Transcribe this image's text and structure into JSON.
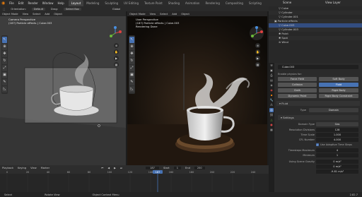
{
  "menu": {
    "items": [
      "File",
      "Edit",
      "Render",
      "Window",
      "Help"
    ]
  },
  "workspaces": [
    "Layout",
    "Modeling",
    "Sculpting",
    "UV Editing",
    "Texture Paint",
    "Shading",
    "Animation",
    "Rendering",
    "Compositing",
    "Scripting"
  ],
  "scene": {
    "name": "Scene",
    "view_layer": "View Layer"
  },
  "toolbar": {
    "transform_label": "Orientation:",
    "orientation_value": "Default",
    "drag_label": "Drag:",
    "select_box": "Select Box",
    "mode": "Object Mode",
    "view": "View",
    "select": "Select",
    "add": "Add",
    "object": "Object",
    "global": "Global"
  },
  "viewport_left": {
    "header": {
      "mode": "Object Mode",
      "view": "View",
      "select": "Select",
      "add": "Add",
      "object": "Object",
      "shading": "Normal"
    },
    "overlay_line1": "Camera Perspective",
    "overlay_line2": "(187) Particle effects | Cube.003"
  },
  "viewport_right": {
    "header": {
      "mode": "Object Mode",
      "view": "View",
      "select": "Select",
      "add": "Add",
      "object": "Object",
      "shading": "Smoke"
    },
    "overlay_line1": "User Perspective",
    "overlay_line2": "(187) Particle effects | Cube.003",
    "overlay_line3": "Rendering Done"
  },
  "outliner": {
    "rows": [
      {
        "label": "Cube",
        "indent": 2
      },
      {
        "label": "Cylinder",
        "indent": 2
      },
      {
        "label": "Cylinder.001",
        "indent": 2
      },
      {
        "label": "Particle effects",
        "indent": 1
      },
      {
        "label": "Cube.003",
        "indent": 2
      },
      {
        "label": "Cylinder.003",
        "indent": 2
      },
      {
        "label": "Point",
        "indent": 2
      },
      {
        "label": "Spot",
        "indent": 2
      },
      {
        "label": "Wind",
        "indent": 2
      }
    ],
    "selected_index": 4
  },
  "properties": {
    "object_name": "Cube.003",
    "enable_label": "Enable physics for:",
    "physics_buttons": [
      {
        "label": "Force Field",
        "active": false
      },
      {
        "label": "Soft Body",
        "active": false
      },
      {
        "label": "Collision",
        "active": false
      },
      {
        "label": "Fluid",
        "active": true
      },
      {
        "label": "Cloth",
        "active": false
      },
      {
        "label": "Rigid Body",
        "active": false
      },
      {
        "label": "Dynamic Paint",
        "active": false
      },
      {
        "label": "Rigid Body Constraint",
        "active": false
      }
    ],
    "fluid_panel": "Fluid",
    "type_label": "Type",
    "type_value": "Domain",
    "settings_panel": "Settings",
    "fields": [
      {
        "label": "Domain Type",
        "value": "Gas"
      },
      {
        "label": "Resolution Divisions",
        "value": "128"
      },
      {
        "label": "Time Scale",
        "value": "1.000"
      },
      {
        "label": "CFL Number",
        "value": "4.000"
      },
      {
        "label": "Use Adaptive Time Steps",
        "value": "checkbox"
      },
      {
        "label": "Timesteps Maximum",
        "value": "4"
      },
      {
        "label": "Minimum",
        "value": "1"
      },
      {
        "label": "Using Scene Gravity",
        "value": "0 m/s²"
      },
      {
        "label": "",
        "value": "0 m/s²"
      },
      {
        "label": "",
        "value": "-9.81 m/s²"
      }
    ]
  },
  "timeline": {
    "playback": "Playback",
    "keying": "Keying",
    "view": "View",
    "marker": "Marker",
    "current_frame": "187",
    "start_label": "Start",
    "start": "1",
    "end_label": "End",
    "end": "250",
    "ticks": [
      "0",
      "20",
      "40",
      "60",
      "80",
      "100",
      "120",
      "140",
      "160",
      "180",
      "200",
      "220",
      "240"
    ]
  },
  "status": {
    "select": "Select",
    "rotate": "Rotate View",
    "context": "Object Context Menu",
    "version": "2.82.7"
  },
  "colors": {
    "accent": "#4772b3",
    "active_tab": "#3f3f3f",
    "playhead": "#4772b3",
    "blender_orange": "#e87d0d"
  }
}
